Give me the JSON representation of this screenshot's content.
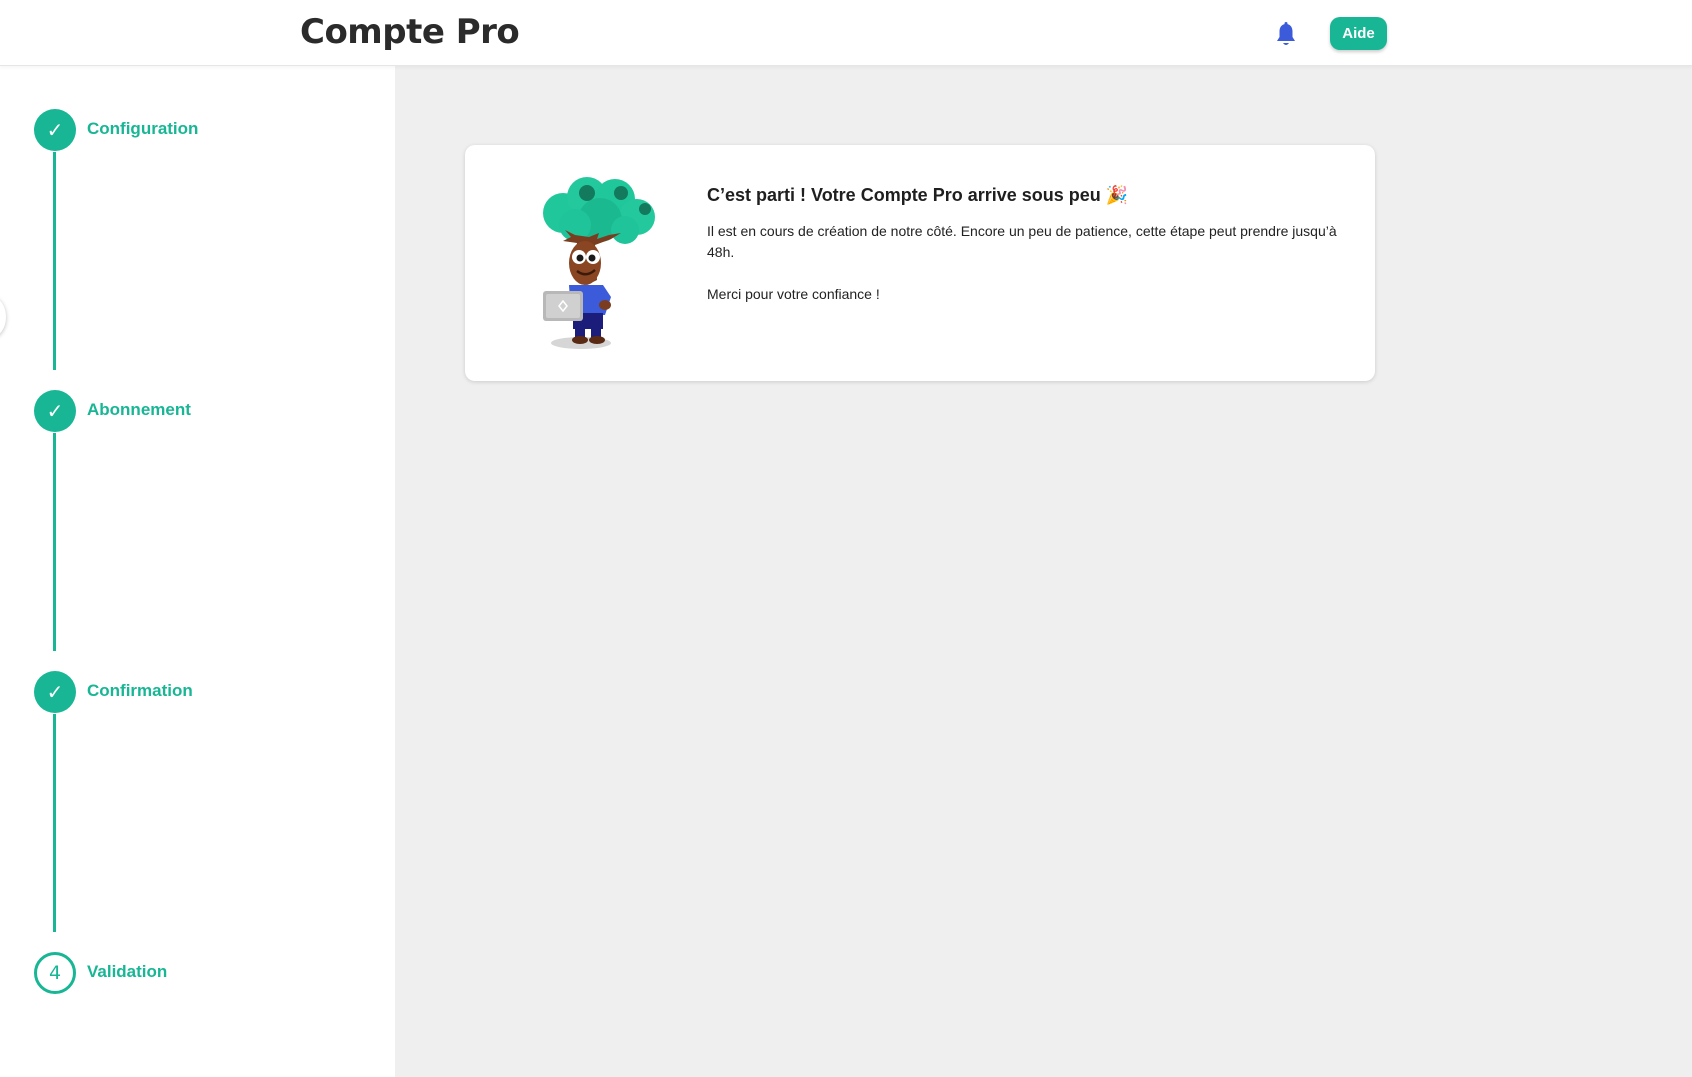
{
  "header": {
    "title": "Compte Pro",
    "help_label": "Aide",
    "notification_icon": "bell-icon"
  },
  "steps": [
    {
      "label": "Configuration",
      "status": "done",
      "marker": "✓"
    },
    {
      "label": "Abonnement",
      "status": "done",
      "marker": "✓"
    },
    {
      "label": "Confirmation",
      "status": "done",
      "marker": "✓"
    },
    {
      "label": "Validation",
      "status": "current",
      "marker": "4"
    }
  ],
  "card": {
    "title": "C’est parti ! Votre Compte Pro arrive sous peu 🎉",
    "text": "Il est en cours de création de notre côté. Encore un peu de patience, cette étape peut prendre jusqu’à 48h.",
    "thanks": "Merci pour votre confiance !",
    "illustration": "tree-mascot-with-laptop"
  },
  "colors": {
    "accent": "#18b694",
    "bell": "#3b5bdb",
    "background": "#efefef"
  }
}
